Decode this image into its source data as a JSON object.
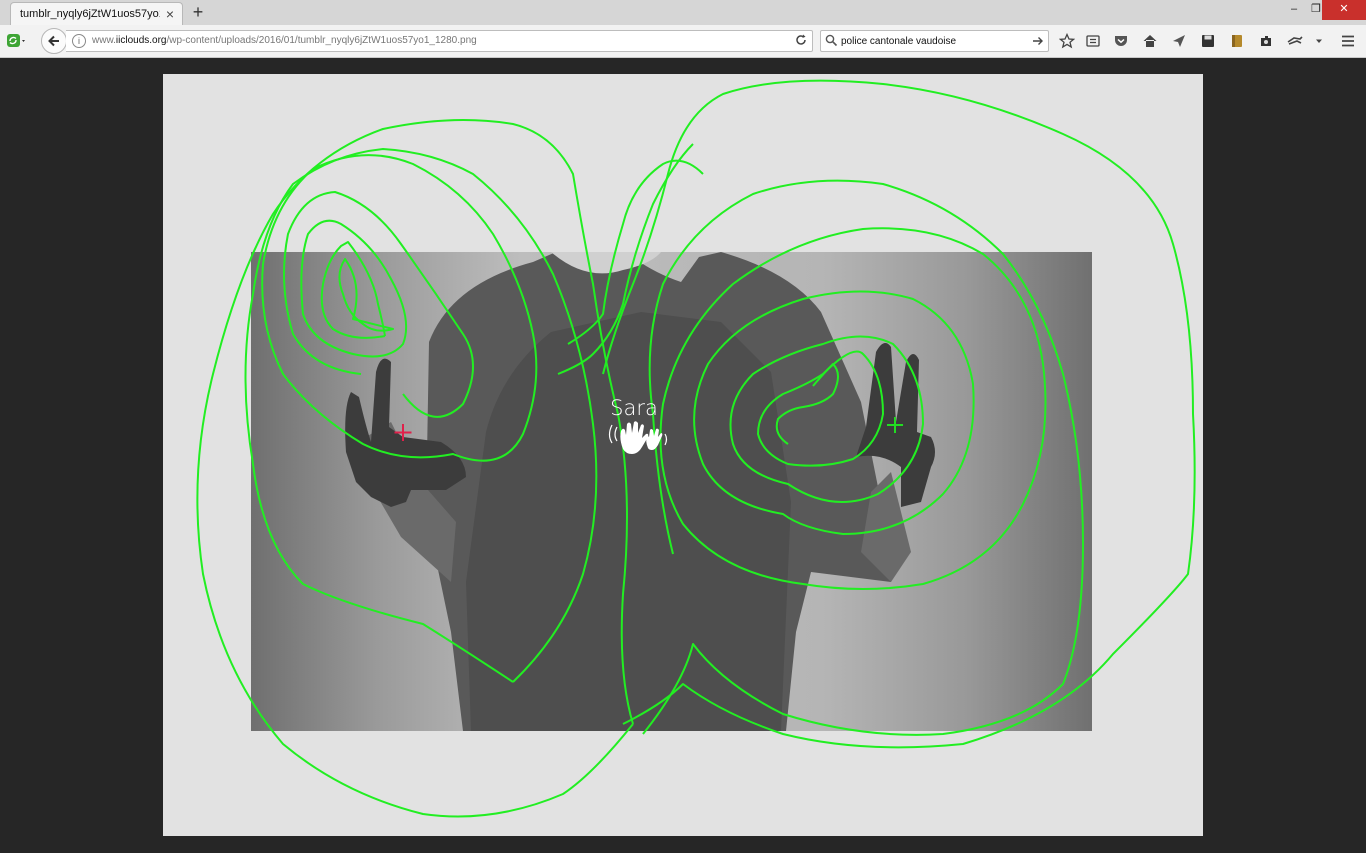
{
  "tab": {
    "title": "tumblr_nyqly6jZtW1uos57yo1...",
    "close_label": "×",
    "new_tab_label": "+"
  },
  "window_controls": {
    "minimize": "–",
    "restore": "❐",
    "close": "✕"
  },
  "address": {
    "prefix": "www.",
    "domain": "iiclouds.org",
    "path": "/wp-content/uploads/2016/01/tumblr_nyqly6jZtW1uos57yo1_1280.png",
    "info_icon": "i"
  },
  "search": {
    "value": "police cantonale vaudoise"
  },
  "toolbar_icons": [
    "bookmark-star-icon",
    "reading-list-icon",
    "pocket-icon",
    "home-icon",
    "send-icon",
    "save-icon",
    "bookmark-icon",
    "extension-icon",
    "extension-2-icon",
    "overflow-icon",
    "menu-icon"
  ],
  "image": {
    "person_label": "Sara",
    "markers": [
      {
        "name": "left-hand-marker",
        "color": "#e0204a"
      },
      {
        "name": "right-hand-marker",
        "color": "#22dd22"
      }
    ],
    "contour_color": "#22ee22"
  }
}
